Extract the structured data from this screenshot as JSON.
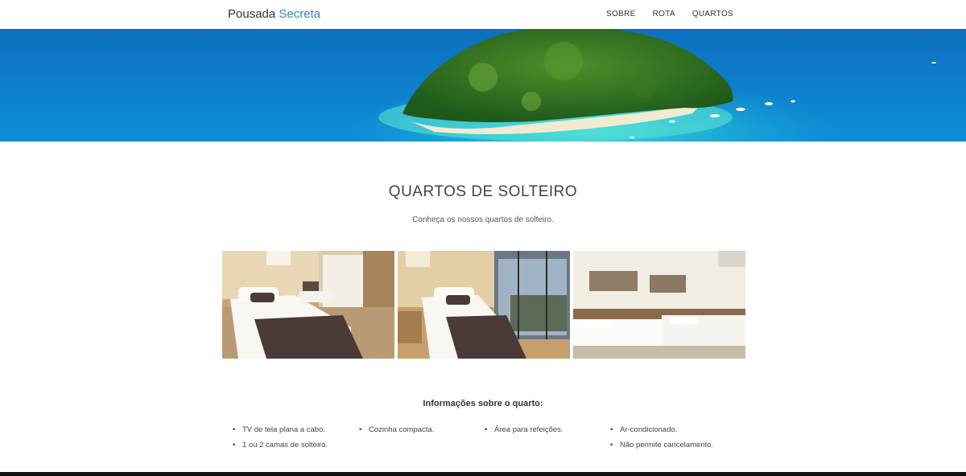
{
  "brand": {
    "part1": "Pousada",
    "part2": "Secreta"
  },
  "nav": {
    "items": [
      "SOBRE",
      "ROTA",
      "QUARTOS"
    ]
  },
  "hero": {
    "image": "island-aerial-photo"
  },
  "section": {
    "title": "QUARTOS DE SOLTEIRO",
    "subtitle": "Conheça os nossos quartos de solteiro."
  },
  "gallery": {
    "photos": [
      "single-room-photo-1",
      "single-room-photo-2",
      "single-room-photo-3"
    ]
  },
  "info": {
    "title": "Informações sobre o quarto:",
    "items": [
      "TV de tela plana a cabo.",
      "1 ou 2 camas de solteiro.",
      "Cozinha compacta.",
      "Área para refeições.",
      "Ar-condicionado.",
      "Não permite cancelamento."
    ]
  },
  "colors": {
    "accent": "#3b7fc4",
    "sea": "#1aa6d6",
    "footer": "#111111"
  }
}
